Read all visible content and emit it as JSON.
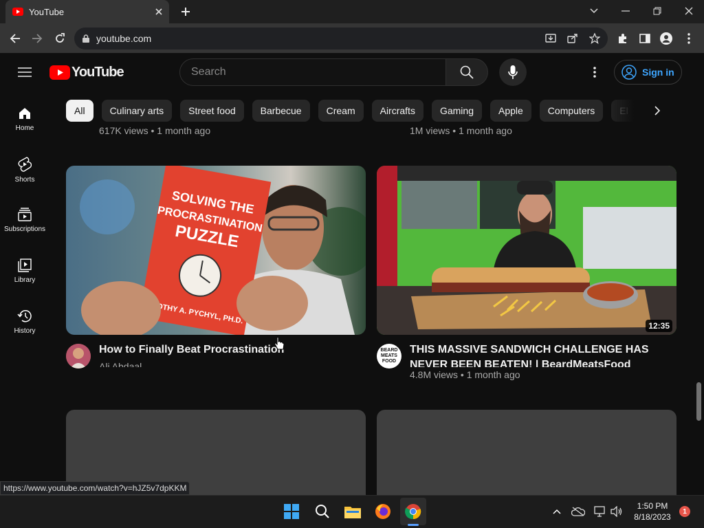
{
  "browser": {
    "tab_title": "YouTube",
    "url": "youtube.com",
    "status_url": "https://www.youtube.com/watch?v=hJZ5v7dpKKM"
  },
  "youtube": {
    "logo_text": "YouTube",
    "search_placeholder": "Search",
    "signin_label": "Sign in",
    "chips": [
      "All",
      "Culinary arts",
      "Street food",
      "Barbecue",
      "Cream",
      "Aircrafts",
      "Gaming",
      "Apple",
      "Computers",
      "El"
    ],
    "sidebar": [
      {
        "label": "Home",
        "icon": "home-icon"
      },
      {
        "label": "Shorts",
        "icon": "shorts-icon"
      },
      {
        "label": "Subscriptions",
        "icon": "subscriptions-icon"
      },
      {
        "label": "Library",
        "icon": "library-icon"
      },
      {
        "label": "History",
        "icon": "history-icon"
      }
    ],
    "prev_row": [
      {
        "meta": "617K views • 1 month ago"
      },
      {
        "meta": "1M views • 1 month ago"
      }
    ],
    "videos": [
      {
        "title": "How to Finally Beat Procrastination",
        "channel": "Ali Abdaal",
        "thumb_book_title": "SOLVING THE PROCRASTINATION PUZZLE",
        "thumb_book_author": "TIMOTHY A. PYCHYL, PH.D."
      },
      {
        "title": "THIS MASSIVE SANDWICH CHALLENGE HAS NEVER BEEN BEATEN! | BeardMeatsFood",
        "meta": "4.8M views • 1 month ago",
        "duration": "12:35",
        "avatar_text": "BEARD MEATS FOOD"
      }
    ]
  },
  "taskbar": {
    "time": "1:50 PM",
    "date": "8/18/2023",
    "notification_count": "1"
  }
}
